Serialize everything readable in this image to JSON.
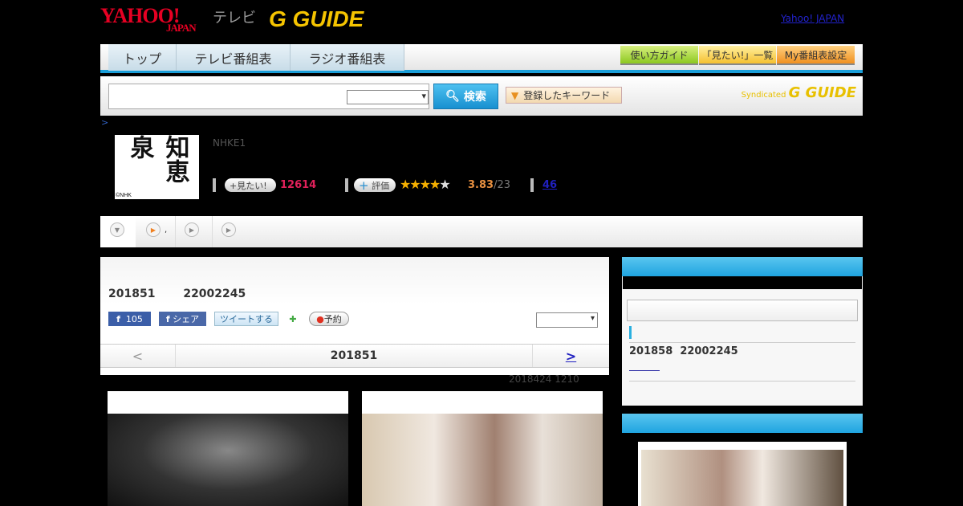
{
  "header": {
    "logo_yahoo": "YAHOO!",
    "logo_japan": "JAPAN",
    "logo_tv": "テレビ",
    "logo_gguide": "G GUIDE",
    "yahoo_japan_link": "Yahoo! JAPAN"
  },
  "nav": {
    "tabs": [
      "トップ",
      "テレビ番組表",
      "ラジオ番組表"
    ],
    "right_buttons": [
      "使い方ガイド",
      "「見たい!」一覧",
      "My番組表設定"
    ]
  },
  "search": {
    "value": "",
    "button": "検索",
    "keyword_button": "登録したキーワード",
    "syndicated": "Syndicated",
    "syndicated_logo": "G GUIDE"
  },
  "breadcrumb": ">",
  "program": {
    "thumb_title": "知恵泉",
    "thumb_credit": "©NHK",
    "channel": "NHKE1",
    "want_button": "+見たい!",
    "want_count": "12614",
    "rate_button": "評価",
    "stars": 3.83,
    "rating": "3.83",
    "rating_count": "/23",
    "review_count": "46"
  },
  "tabs": {
    "items": [
      "",
      ",",
      "",
      ""
    ]
  },
  "main": {
    "date": "201851",
    "time": "22002245",
    "fb_count": "105",
    "share": "シェア",
    "tweet": "ツイートする",
    "reserve": "予約",
    "pager": {
      "prev": "<",
      "current": "201851",
      "next": ">"
    }
  },
  "updated": "2018424  1210",
  "side": {
    "next_date": "201858",
    "next_time": "22002245"
  }
}
